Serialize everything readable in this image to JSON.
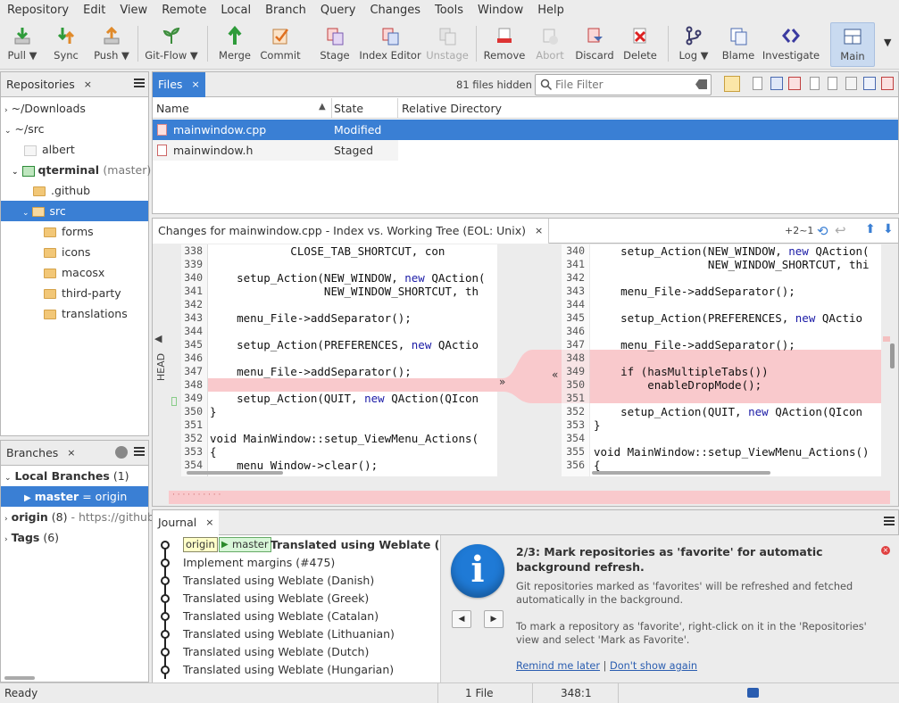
{
  "menu": [
    "Repository",
    "Edit",
    "View",
    "Remote",
    "Local",
    "Branch",
    "Query",
    "Changes",
    "Tools",
    "Window",
    "Help"
  ],
  "toolbar": {
    "pull": "Pull",
    "sync": "Sync",
    "push": "Push",
    "gitflow": "Git-Flow",
    "merge": "Merge",
    "commit": "Commit",
    "stage": "Stage",
    "index_editor": "Index Editor",
    "unstage": "Unstage",
    "remove": "Remove",
    "abort": "Abort",
    "discard": "Discard",
    "delete": "Delete",
    "log": "Log",
    "blame": "Blame",
    "investigate": "Investigate",
    "main": "Main",
    "arrow": "▼"
  },
  "repositories": {
    "tab": "Repositories",
    "items": {
      "downloads": "~/Downloads",
      "src": "~/src",
      "albert": "albert",
      "qterminal": "qterminal",
      "qterminal_branch": "(master)",
      "github": ".github",
      "src_folder": "src",
      "forms": "forms",
      "icons": "icons",
      "macosx": "macosx",
      "third_party": "third-party",
      "translations": "translations"
    }
  },
  "files": {
    "tab": "Files",
    "hidden": "81 files hidden",
    "filter_placeholder": "File Filter",
    "col_name": "Name",
    "col_state": "State",
    "col_dir": "Relative Directory",
    "rows": [
      {
        "name": "mainwindow.cpp",
        "state": "Modified"
      },
      {
        "name": "mainwindow.h",
        "state": "Staged"
      }
    ]
  },
  "diff": {
    "tab": "Changes for mainwindow.cpp - Index vs. Working Tree (EOL: Unix)",
    "counter": "+2~1",
    "head": "HEAD",
    "left_nums": [
      "338",
      "339",
      "340",
      "341",
      "342",
      "343",
      "344",
      "345",
      "346",
      "347",
      "348",
      "349",
      "350",
      "351",
      "352",
      "353",
      "354"
    ],
    "left_code": [
      "            CLOSE_TAB_SHORTCUT, con",
      "",
      "    setup_Action(NEW_WINDOW, new QAction(",
      "                 NEW_WINDOW_SHORTCUT, th",
      "",
      "    menu_File->addSeparator();",
      "",
      "    setup_Action(PREFERENCES, new QActio",
      "",
      "    menu_File->addSeparator();",
      "",
      "    setup_Action(QUIT, new QAction(QIcon",
      "}",
      "",
      "void MainWindow::setup_ViewMenu_Actions(",
      "{",
      "    menu_Window->clear();"
    ],
    "right_nums": [
      "340",
      "341",
      "342",
      "343",
      "344",
      "345",
      "346",
      "347",
      "348",
      "349",
      "350",
      "351",
      "352",
      "353",
      "354",
      "355",
      "356"
    ],
    "right_code": [
      "    setup_Action(NEW_WINDOW, new QAction(",
      "                 NEW_WINDOW_SHORTCUT, thi",
      "",
      "    menu_File->addSeparator();",
      "",
      "    setup_Action(PREFERENCES, new QActio",
      "",
      "    menu_File->addSeparator();",
      "",
      "    if (hasMultipleTabs())",
      "        enableDropMode();",
      "",
      "    setup_Action(QUIT, new QAction(QIcon",
      "}",
      "",
      "void MainWindow::setup_ViewMenu_Actions()",
      "{"
    ],
    "arrow_right": "»",
    "arrow_left": "«",
    "dots": "· · · · · · · · · ·"
  },
  "branches": {
    "tab": "Branches",
    "local": "Local Branches",
    "local_count": "(1)",
    "master": "master",
    "master_suffix": "= origin",
    "origin": "origin",
    "origin_count": "(8)",
    "origin_url": "- https://github.co",
    "tags": "Tags",
    "tags_count": "(6)"
  },
  "journal": {
    "tab": "Journal",
    "tag_origin": "origin",
    "tag_master": "master",
    "commits": [
      "Translated using Weblate (Hebr",
      "Implement margins (#475)",
      "Translated using Weblate (Danish)",
      "Translated using Weblate (Greek)",
      "Translated using Weblate (Catalan)",
      "Translated using Weblate (Lithuanian)",
      "Translated using Weblate (Dutch)",
      "Translated using Weblate (Hungarian)"
    ]
  },
  "tip": {
    "title": "2/3: Mark repositories as 'favorite' for automatic background refresh.",
    "p1": "Git repositories marked as 'favorites' will be refreshed and fetched automatically in the background.",
    "p2": "To mark a repository as 'favorite', right-click on it in the 'Repositories' view and select 'Mark as Favorite'.",
    "remind": "Remind me later",
    "sep": "|",
    "dont": "Don't show again",
    "icon": "i"
  },
  "status": {
    "ready": "Ready",
    "files": "1 File",
    "pos": "348:1"
  },
  "colors": {
    "accent": "#3a7fd4",
    "diff_pink": "#f9c9cc"
  }
}
